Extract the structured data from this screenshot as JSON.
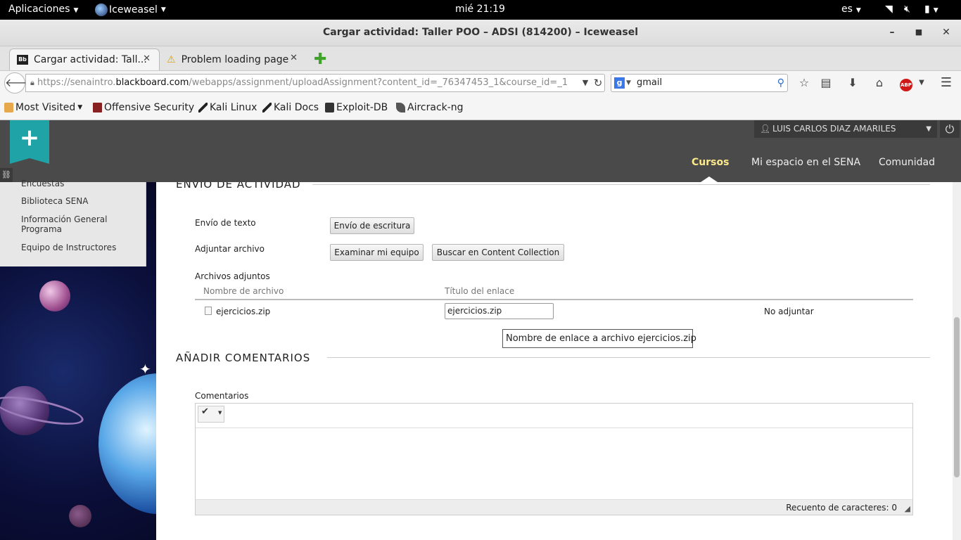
{
  "gnome": {
    "apps": "Aplicaciones",
    "app": "Iceweasel",
    "clock": "mié 21:19",
    "lang": "es"
  },
  "window": {
    "title": "Cargar actividad: Taller POO – ADSI (814200) – Iceweasel"
  },
  "tabs": [
    {
      "label": "Cargar actividad: Tall..."
    },
    {
      "label": "Problem loading page"
    }
  ],
  "nav": {
    "url_prefix": "https://senaintro.",
    "url_domain": "blackboard.com",
    "url_rest": "/webapps/assignment/uploadAssignment?content_id=_76347453_1&course_id=_1",
    "search_value": "gmail"
  },
  "bookmarks": [
    "Most Visited",
    "Offensive Security",
    "Kali Linux",
    "Kali Docs",
    "Exploit-DB",
    "Aircrack-ng"
  ],
  "header": {
    "user": "LUIS CARLOS DIAZ AMARILES",
    "nav": [
      "Cursos",
      "Mi espacio en el SENA",
      "Comunidad"
    ]
  },
  "menu": [
    "Encuestas",
    "Biblioteca SENA",
    "Información General Programa",
    "Equipo de Instructores"
  ],
  "envio": {
    "section_title": "ENVÍO DE ACTIVIDAD",
    "texto_label": "Envío de texto",
    "texto_button": "Envío de escritura",
    "adjuntar_label": "Adjuntar archivo",
    "examinar_button": "Examinar mi equipo",
    "buscar_button": "Buscar en Content Collection",
    "archivos_label": "Archivos adjuntos",
    "col_nombre": "Nombre de archivo",
    "col_titulo": "Título del enlace",
    "file_name": "ejercicios.zip",
    "link_title": "ejercicios.zip",
    "no_adjuntar": "No adjuntar",
    "tooltip": "Nombre de enlace a archivo ejercicios.zip"
  },
  "comentarios": {
    "section_title": "AÑADIR COMENTARIOS",
    "label": "Comentarios",
    "char_count": "Recuento de caracteres: 0"
  }
}
